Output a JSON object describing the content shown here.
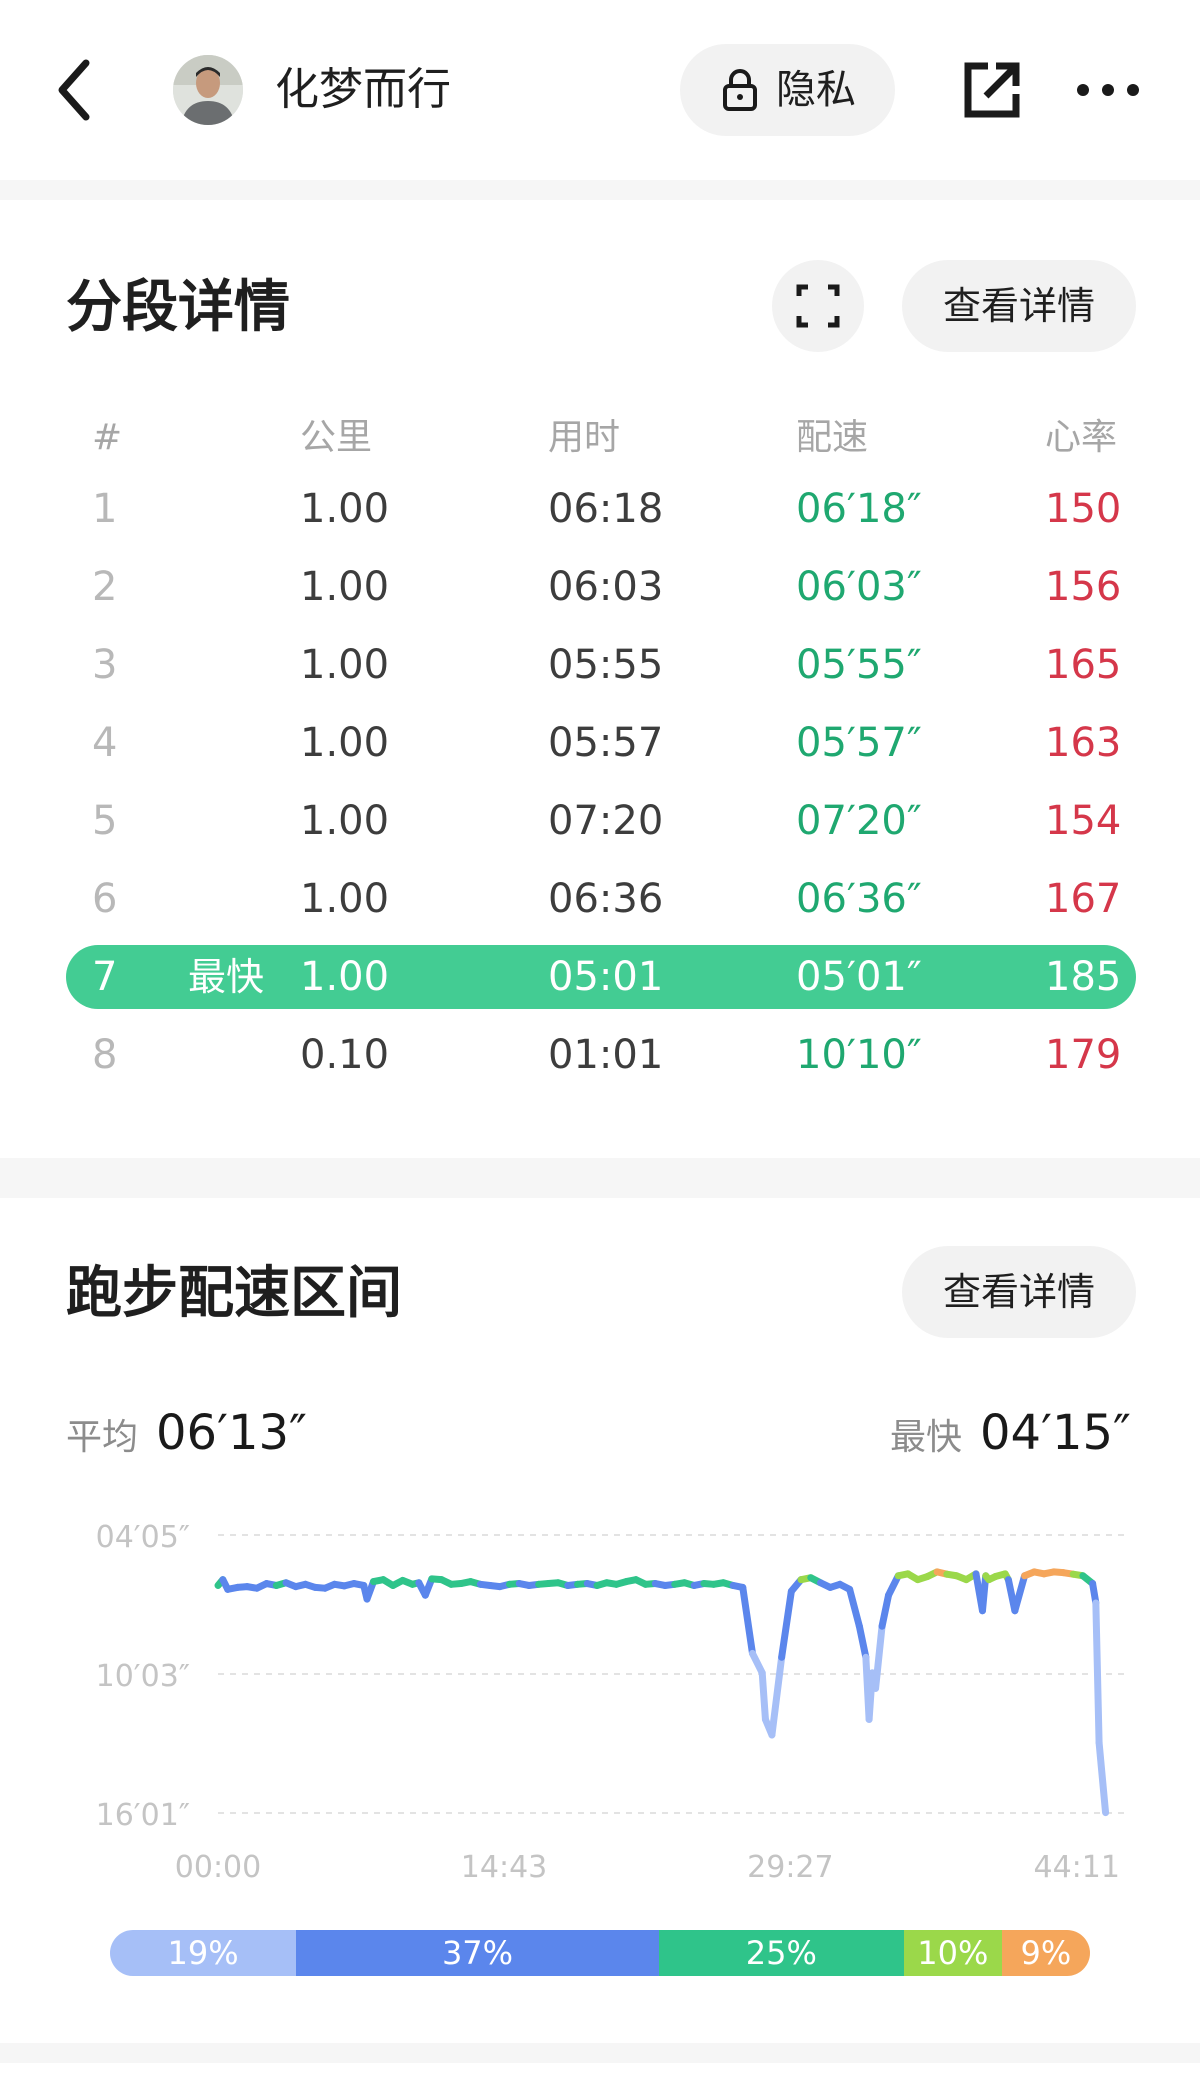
{
  "header": {
    "username": "化梦而行",
    "privacy_label": "隐私",
    "icons": [
      "back-arrow-icon",
      "lock-icon",
      "share-icon",
      "more-icon"
    ]
  },
  "splits": {
    "title": "分段详情",
    "detail_label": "查看详情",
    "columns": [
      "#",
      "公里",
      "用时",
      "配速",
      "心率"
    ],
    "rows": [
      {
        "idx": "1",
        "tag": "",
        "km": "1.00",
        "time": "06:18",
        "pace": "06′18″",
        "hr": "150"
      },
      {
        "idx": "2",
        "tag": "",
        "km": "1.00",
        "time": "06:03",
        "pace": "06′03″",
        "hr": "156"
      },
      {
        "idx": "3",
        "tag": "",
        "km": "1.00",
        "time": "05:55",
        "pace": "05′55″",
        "hr": "165"
      },
      {
        "idx": "4",
        "tag": "",
        "km": "1.00",
        "time": "05:57",
        "pace": "05′57″",
        "hr": "163"
      },
      {
        "idx": "5",
        "tag": "",
        "km": "1.00",
        "time": "07:20",
        "pace": "07′20″",
        "hr": "154"
      },
      {
        "idx": "6",
        "tag": "",
        "km": "1.00",
        "time": "06:36",
        "pace": "06′36″",
        "hr": "167"
      },
      {
        "idx": "7",
        "tag": "最快",
        "km": "1.00",
        "time": "05:01",
        "pace": "05′01″",
        "hr": "185"
      },
      {
        "idx": "8",
        "tag": "",
        "km": "0.10",
        "time": "01:01",
        "pace": "10′10″",
        "hr": "179"
      }
    ],
    "colors": {
      "pace": "#1fa870",
      "hr": "#d5374a",
      "highlight": "#43cc93"
    }
  },
  "pace_zone": {
    "title": "跑步配速区间",
    "detail_label": "查看详情",
    "avg_label": "平均",
    "avg_value": "06′13″",
    "fastest_label": "最快",
    "fastest_value": "04′15″",
    "distribution": [
      {
        "label": "19%",
        "value": 19,
        "color": "#a6bff7"
      },
      {
        "label": "37%",
        "value": 37,
        "color": "#5b86ec"
      },
      {
        "label": "25%",
        "value": 25,
        "color": "#2fc48a"
      },
      {
        "label": "10%",
        "value": 10,
        "color": "#9bd84a"
      },
      {
        "label": "9%",
        "value": 9,
        "color": "#f5a65b"
      }
    ]
  },
  "chart_data": {
    "type": "line",
    "title": "",
    "xlabel": "",
    "ylabel": "",
    "x_tick_labels": [
      "00:00",
      "14:43",
      "29:27",
      "44:11"
    ],
    "y_tick_labels": [
      "04′05″",
      "10′03″",
      "16′01″"
    ],
    "y_ticks_seconds": [
      245,
      603,
      961
    ],
    "x_ticks_seconds": [
      0,
      883,
      1767,
      2651
    ],
    "y_inverted": true,
    "xlim_seconds": [
      0,
      2800
    ],
    "ylim_seconds": [
      245,
      961
    ],
    "grid": true,
    "series": [
      {
        "x_seconds": [
          0,
          15,
          30,
          60,
          90,
          120,
          150,
          180,
          210,
          240,
          270,
          300,
          330,
          360,
          390,
          420,
          450,
          460,
          480,
          510,
          540,
          570,
          600,
          620,
          640,
          660,
          690,
          720,
          750,
          780,
          810,
          840,
          870,
          900,
          930,
          960,
          990,
          1020,
          1050,
          1080,
          1110,
          1140,
          1170,
          1200,
          1230,
          1260,
          1290,
          1320,
          1350,
          1380,
          1410,
          1440,
          1470,
          1500,
          1530,
          1560,
          1590,
          1620,
          1650,
          1680,
          1690,
          1710,
          1740,
          1770,
          1800,
          1830,
          1860,
          1890,
          1920,
          1950,
          1980,
          2000,
          2010,
          2020,
          2030,
          2050,
          2070,
          2100,
          2130,
          2160,
          2190,
          2220,
          2250,
          2280,
          2310,
          2340,
          2360,
          2370,
          2380,
          2400,
          2430,
          2440,
          2460,
          2490,
          2520,
          2550,
          2580,
          2610,
          2640,
          2670,
          2700,
          2710,
          2720,
          2740
        ],
        "y_seconds": [
          375,
          360,
          385,
          380,
          378,
          382,
          370,
          375,
          368,
          378,
          372,
          380,
          382,
          372,
          376,
          370,
          375,
          410,
          365,
          360,
          375,
          362,
          372,
          368,
          400,
          358,
          360,
          372,
          370,
          365,
          372,
          375,
          378,
          372,
          370,
          375,
          372,
          370,
          368,
          375,
          372,
          370,
          375,
          368,
          372,
          365,
          360,
          372,
          370,
          375,
          372,
          368,
          375,
          370,
          372,
          368,
          375,
          380,
          550,
          600,
          720,
          760,
          560,
          390,
          360,
          355,
          368,
          380,
          372,
          385,
          480,
          560,
          720,
          600,
          640,
          480,
          400,
          350,
          345,
          360,
          352,
          340,
          346,
          350,
          360,
          345,
          440,
          350,
          360,
          352,
          345,
          360,
          440,
          350,
          340,
          345,
          340,
          342,
          346,
          350,
          370,
          420,
          780,
          960
        ]
      }
    ]
  }
}
